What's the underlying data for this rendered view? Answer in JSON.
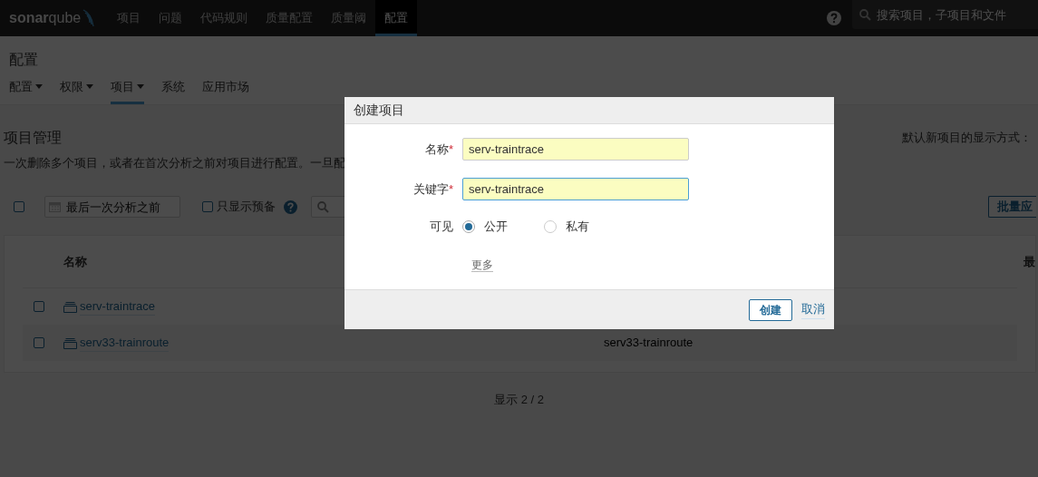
{
  "top_nav": {
    "logo": "**sonar**qube",
    "items": [
      {
        "label": "项目",
        "selected": false
      },
      {
        "label": "问题",
        "selected": false
      },
      {
        "label": "代码规则",
        "selected": false
      },
      {
        "label": "质量配置",
        "selected": false
      },
      {
        "label": "质量阈",
        "selected": false
      },
      {
        "label": "配置",
        "selected": true
      }
    ],
    "search": {
      "placeholder": "搜索项目，子项目和文件"
    }
  },
  "page": {
    "title": "配置",
    "tabs": [
      {
        "label": "配置",
        "dropdown": true,
        "selected": false
      },
      {
        "label": "权限",
        "dropdown": true,
        "selected": false
      },
      {
        "label": "项目",
        "dropdown": true,
        "selected": true
      },
      {
        "label": "系统",
        "dropdown": false,
        "selected": false
      },
      {
        "label": "应用市场",
        "dropdown": false,
        "selected": false
      }
    ]
  },
  "section": {
    "title": "项目管理",
    "description": "一次删除多个项目，或者在首次分析之前对项目进行配置。一旦配",
    "default_visibility_label": "默认新项目的显示方式："
  },
  "toolbar": {
    "select_all_checked": false,
    "date_placeholder": "最后一次分析之前",
    "provisioned": {
      "label": "只显示预备",
      "checked": false
    },
    "bulk_button": "批量应"
  },
  "table": {
    "columns": [
      "名称",
      "最"
    ],
    "rows": [
      {
        "name": "serv-traintrace",
        "checked": false
      },
      {
        "name": "serv33-trainroute",
        "key": "serv33-trainroute",
        "checked": false
      }
    ]
  },
  "footer": "显示 2 / 2",
  "dialog": {
    "title": "创建项目",
    "fields": [
      {
        "label": "名称",
        "required_mark": "*",
        "value": "serv-traintrace",
        "focused": false
      },
      {
        "label": "关键字",
        "required_mark": "*",
        "value": "serv-traintrace",
        "focused": true
      }
    ],
    "visibility": {
      "label": "可见",
      "options": [
        {
          "label": "公开",
          "selected": true
        },
        {
          "label": "私有",
          "selected": false
        }
      ]
    },
    "more_link": "更多",
    "buttons": [
      {
        "label": "创建",
        "kind": "primary"
      },
      {
        "label": "取消",
        "kind": "link"
      }
    ]
  }
}
